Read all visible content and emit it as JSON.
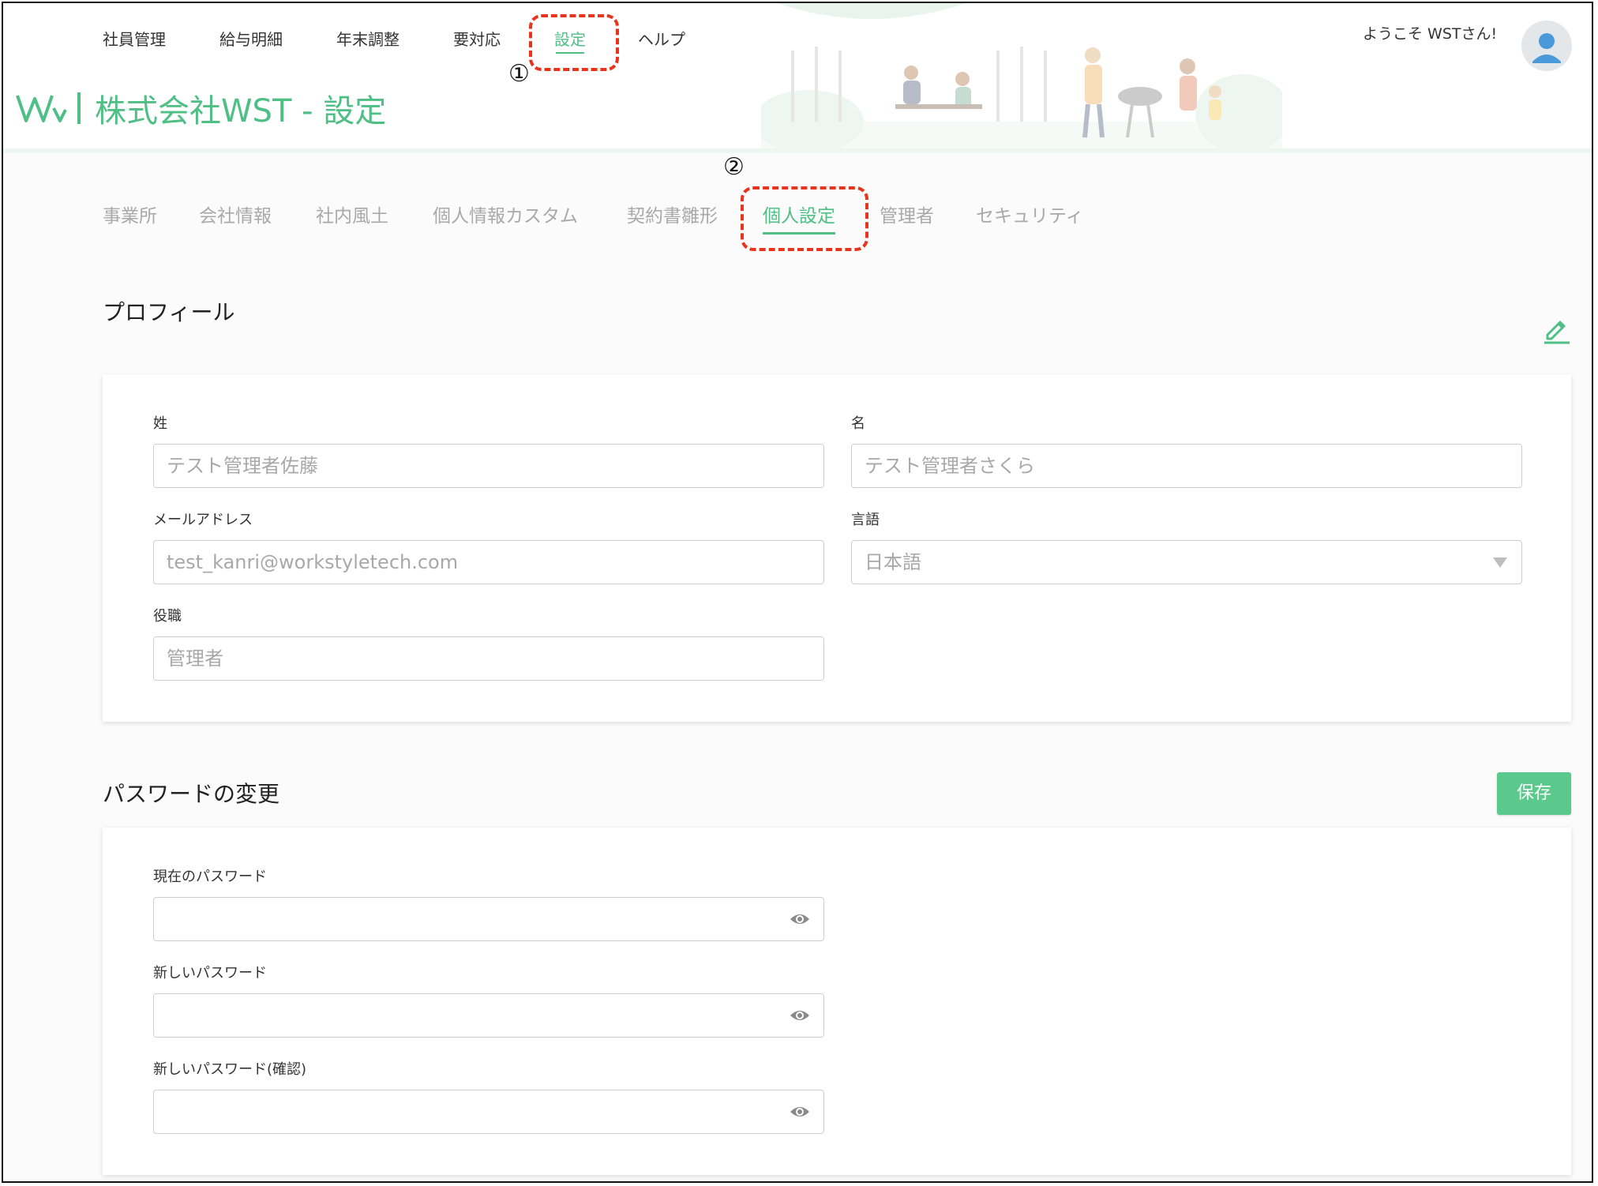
{
  "top_nav": {
    "items": [
      {
        "label": "社員管理"
      },
      {
        "label": "給与明細"
      },
      {
        "label": "年末調整"
      },
      {
        "label": "要対応"
      },
      {
        "label": "設定"
      },
      {
        "label": "ヘルプ"
      }
    ],
    "active_index": 4
  },
  "brand": {
    "title": "株式会社WST - 設定"
  },
  "user": {
    "welcome": "ようこそ WSTさん!"
  },
  "annotations": {
    "step1": "①",
    "step2": "②"
  },
  "tabs": {
    "items": [
      {
        "label": "事業所"
      },
      {
        "label": "会社情報"
      },
      {
        "label": "社内風土"
      },
      {
        "label": "個人情報カスタム"
      },
      {
        "label": "契約書雛形"
      },
      {
        "label": "個人設定"
      },
      {
        "label": "管理者"
      },
      {
        "label": "セキュリティ"
      }
    ],
    "active_index": 5
  },
  "profile": {
    "title": "プロフィール",
    "last_name": {
      "label": "姓",
      "placeholder": "テスト管理者佐藤"
    },
    "first_name": {
      "label": "名",
      "placeholder": "テスト管理者さくら"
    },
    "email": {
      "label": "メールアドレス",
      "placeholder": "test_kanri@workstyletech.com"
    },
    "language": {
      "label": "言語",
      "value": "日本語"
    },
    "position": {
      "label": "役職",
      "placeholder": "管理者"
    }
  },
  "password": {
    "title": "パスワードの変更",
    "save_label": "保存",
    "current": {
      "label": "現在のパスワード"
    },
    "new": {
      "label": "新しいパスワード"
    },
    "confirm": {
      "label": "新しいパスワード(確認)"
    }
  },
  "colors": {
    "accent": "#4fbf85",
    "save_button": "#5cc98c",
    "annotation_red": "#e8341c"
  }
}
